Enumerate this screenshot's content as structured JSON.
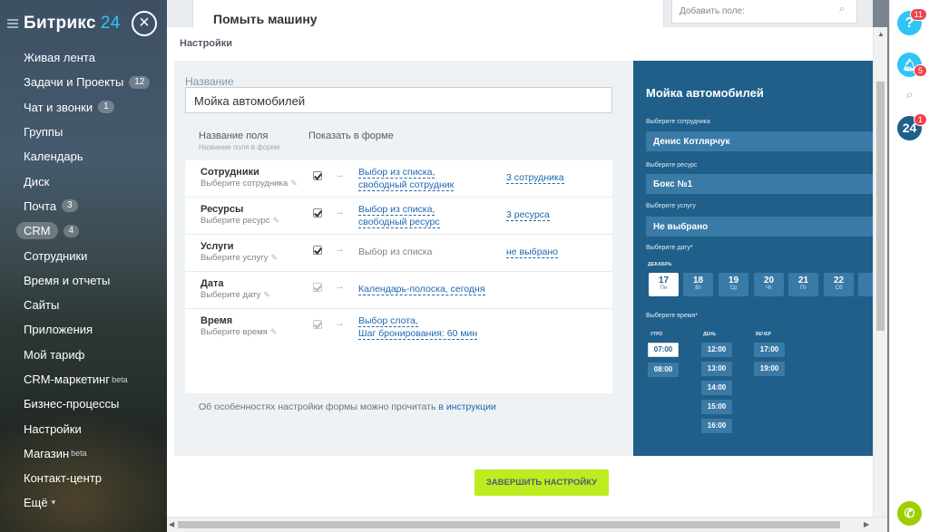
{
  "sidebar": {
    "logo_main": "Битрикс",
    "logo_num": "24",
    "menu": [
      {
        "label": "Живая лента"
      },
      {
        "label": "Задачи и Проекты",
        "count": "12"
      },
      {
        "label": "Чат и звонки",
        "count": "1"
      },
      {
        "label": "Группы"
      },
      {
        "label": "Календарь"
      },
      {
        "label": "Диск"
      },
      {
        "label": "Почта",
        "count": "3"
      },
      {
        "label": "CRM",
        "count": "4"
      },
      {
        "label": "Сотрудники"
      },
      {
        "label": "Время и отчеты"
      },
      {
        "label": "Сайты"
      },
      {
        "label": "Приложения"
      },
      {
        "label": "Мой тариф"
      },
      {
        "label": "CRM-маркетинг",
        "sup": "beta"
      },
      {
        "label": "Бизнес-процессы"
      },
      {
        "label": "Настройки"
      },
      {
        "label": "Магазин",
        "sup": "beta"
      },
      {
        "label": "Контакт-центр"
      },
      {
        "label": "Ещё"
      }
    ]
  },
  "background": {
    "card_title": "Помыть машину",
    "add_field_placeholder": "Добавить поле:"
  },
  "panel": {
    "title": "Настройки",
    "name_label": "Название",
    "name_value": "Мойка автомобилей",
    "col_field_name": "Название поля",
    "col_field_sub": "Название поля в форме",
    "col_show": "Показать в форме",
    "rows": [
      {
        "name": "Сотрудники",
        "hint": "Выберите сотрудника",
        "opt1": "Выбор из списка,",
        "opt2": "свободный сотрудник",
        "value": "3 сотрудника"
      },
      {
        "name": "Ресурсы",
        "hint": "Выберите ресурс",
        "opt1": "Выбор из списка,",
        "opt2": "свободный ресурс",
        "value": "3 ресурса"
      },
      {
        "name": "Услуги",
        "hint": "Выберите услугу",
        "opt1": "Выбор из списка",
        "value": "не выбрано"
      },
      {
        "name": "Дата",
        "hint": "Выберите дату",
        "opt1": "Календарь-полоска, сегодня"
      },
      {
        "name": "Время",
        "hint": "Выберите время",
        "opt1": "Выбор слота,",
        "opt2": "Шаг бронирования: 60 мин"
      }
    ],
    "note_text": "Об особенностях настройки формы можно прочитать",
    "note_link": "в инструкции",
    "finish_button": "ЗАВЕРШИТЬ НАСТРОЙКУ"
  },
  "preview": {
    "title": "Мойка автомобилей",
    "employee_label": "Выберите сотрудника",
    "employee_value": "Денис Котлярчук",
    "resource_label": "Выберите ресурс",
    "resource_value": "Бокс №1",
    "service_label": "Выберите услугу",
    "service_value": "Не выбрано",
    "date_label": "Выберите дату*",
    "month": "ДЕКАБРЬ",
    "days": [
      {
        "num": "17",
        "wd": "Пн"
      },
      {
        "num": "18",
        "wd": "Вт"
      },
      {
        "num": "19",
        "wd": "Ср"
      },
      {
        "num": "20",
        "wd": "Чт"
      },
      {
        "num": "21",
        "wd": "Пт"
      },
      {
        "num": "22",
        "wd": "Сб"
      }
    ],
    "time_label": "Выберите время*",
    "morning": "УТРО",
    "day": "ДЕНЬ",
    "evening": "ВЕЧЕР",
    "morning_slots": [
      "07:00",
      "08:00"
    ],
    "day_slots": [
      "12:00",
      "13:00",
      "14:00",
      "15:00",
      "16:00"
    ],
    "evening_slots": [
      "17:00",
      "19:00"
    ]
  },
  "rightbar": {
    "help_badge": "11",
    "bell_badge": "5",
    "b24_badge": "1",
    "b24_label": "24"
  }
}
